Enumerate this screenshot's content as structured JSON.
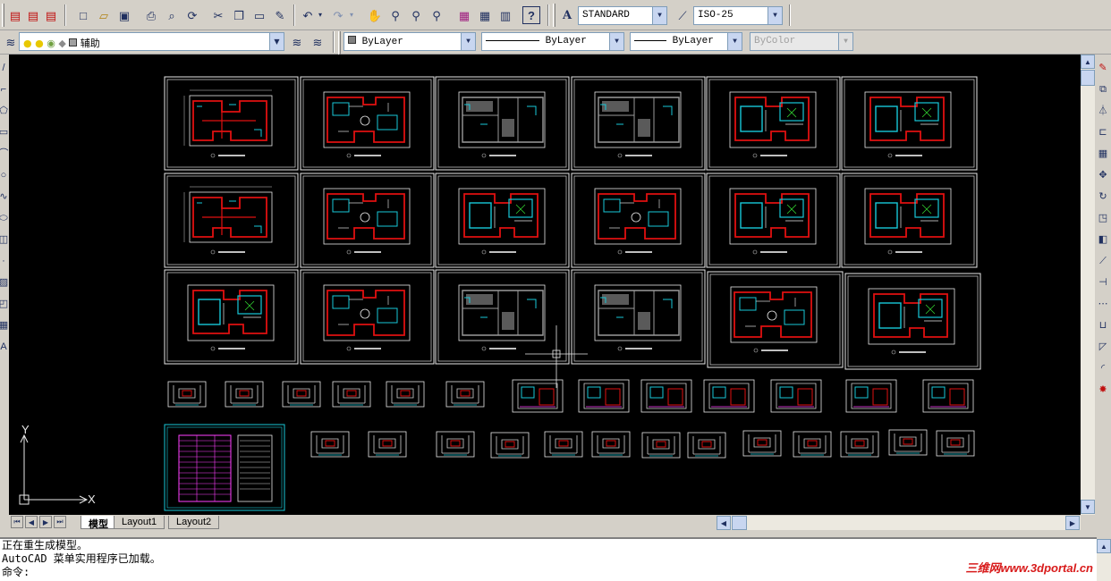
{
  "toolbar": {
    "text_style": "STANDARD",
    "dim_style": "ISO-25"
  },
  "layers": {
    "current_layer": "辅助",
    "color": "ByLayer",
    "linetype": "ByLayer",
    "lineweight": "ByLayer",
    "plot_style": "ByColor"
  },
  "drawing": {
    "ucs_x_label": "X",
    "ucs_y_label": "Y"
  },
  "tabs": [
    {
      "label": "模型"
    },
    {
      "label": "Layout1"
    },
    {
      "label": "Layout2"
    }
  ],
  "command": {
    "lines": [
      "正在重生成模型。",
      "AutoCAD 菜单实用程序已加载。",
      "命令:"
    ]
  },
  "watermark": "三维网www.3dportal.cn",
  "colors": {
    "wall": "#e01010",
    "detail": "#18c8d8",
    "line": "#e8e8e8",
    "accent": "#ff40ff"
  }
}
